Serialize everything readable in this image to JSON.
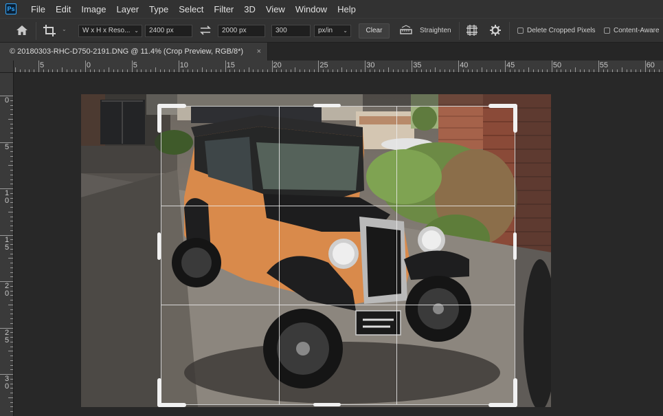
{
  "app": {
    "logo": "Ps"
  },
  "menu": [
    "File",
    "Edit",
    "Image",
    "Layer",
    "Type",
    "Select",
    "Filter",
    "3D",
    "View",
    "Window",
    "Help"
  ],
  "options": {
    "home_icon": "home-icon",
    "crop_icon": "crop-tool-icon",
    "ratio_preset": "W x H x Reso...",
    "width": "2400 px",
    "swap_icon": "swap-arrows-icon",
    "height": "2000 px",
    "resolution": "300",
    "resolution_unit": "px/in",
    "clear_label": "Clear",
    "straighten_label": "Straighten",
    "delete_cropped_label": "Delete Cropped Pixels",
    "delete_cropped_checked": false,
    "content_aware_label": "Content-Aware",
    "content_aware_checked": false
  },
  "document": {
    "tab_title": "© 20180303-RHC-D750-2191.DNG @ 11.4% (Crop Preview, RGB/8*)",
    "close_glyph": "×"
  },
  "rulers": {
    "top_labels": [
      "5",
      "0",
      "5",
      "10",
      "15",
      "20",
      "25",
      "30",
      "35",
      "40",
      "45",
      "50",
      "55",
      "60"
    ],
    "left_labels": [
      "0",
      "5",
      "10",
      "15",
      "20",
      "25",
      "30"
    ]
  },
  "colors": {
    "accent": "#31a8ff",
    "background": "#282828",
    "panel": "#323232"
  }
}
